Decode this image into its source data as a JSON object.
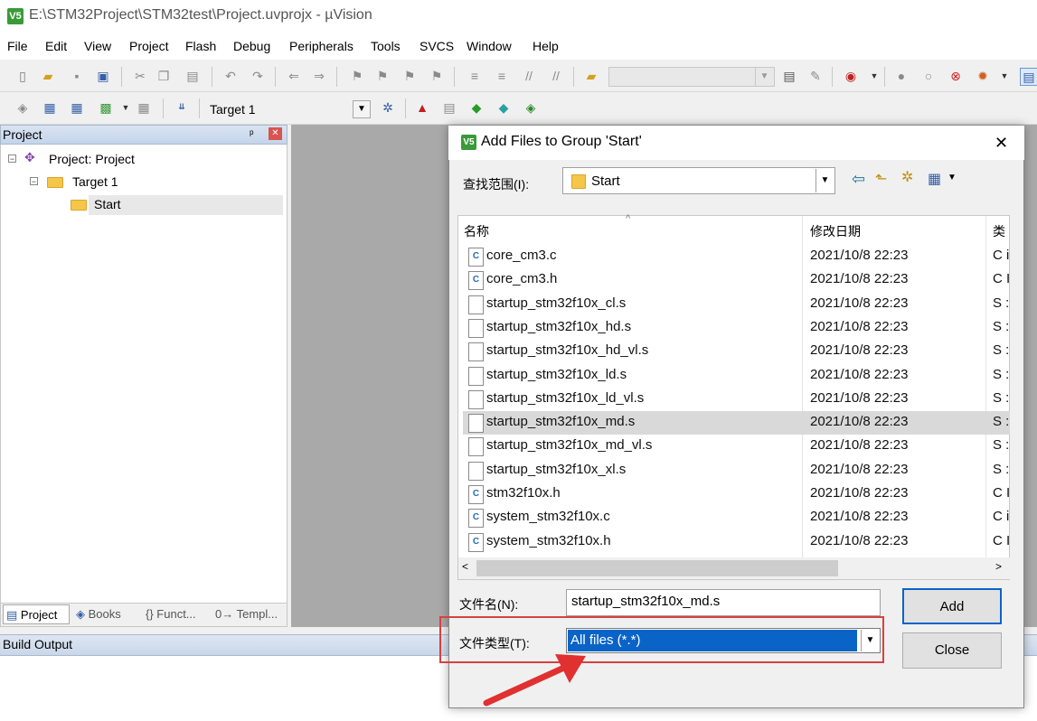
{
  "window": {
    "title": "E:\\STM32Project\\STM32test\\Project.uvprojx - µVision",
    "icon": "V5"
  },
  "menu": [
    "File",
    "Edit",
    "View",
    "Project",
    "Flash",
    "Debug",
    "Peripherals",
    "Tools",
    "SVCS",
    "Window",
    "Help"
  ],
  "toolbar2": {
    "target": "Target 1"
  },
  "project_panel": {
    "header": "Project",
    "tree": {
      "root": "Project: Project",
      "target": "Target 1",
      "group": "Start"
    },
    "tabs": [
      "Project",
      "Books",
      "{} Funct...",
      "0→ Templ..."
    ]
  },
  "build_output": {
    "label": "Build Output"
  },
  "dialog": {
    "title": "Add Files to Group 'Start'",
    "look_in_label": "查找范围(I):",
    "look_in_value": "Start",
    "columns": {
      "name": "名称",
      "date": "修改日期",
      "type": "类"
    },
    "files": [
      {
        "name": "core_cm3.c",
        "date": "2021/10/8 22:23",
        "type": "C i",
        "icon": "c-file-icon"
      },
      {
        "name": "core_cm3.h",
        "date": "2021/10/8 22:23",
        "type": "C I",
        "icon": "c-file-icon"
      },
      {
        "name": "startup_stm32f10x_cl.s",
        "date": "2021/10/8 22:23",
        "type": "S :",
        "icon": "blank-file-icon"
      },
      {
        "name": "startup_stm32f10x_hd.s",
        "date": "2021/10/8 22:23",
        "type": "S :",
        "icon": "blank-file-icon"
      },
      {
        "name": "startup_stm32f10x_hd_vl.s",
        "date": "2021/10/8 22:23",
        "type": "S :",
        "icon": "blank-file-icon"
      },
      {
        "name": "startup_stm32f10x_ld.s",
        "date": "2021/10/8 22:23",
        "type": "S :",
        "icon": "blank-file-icon"
      },
      {
        "name": "startup_stm32f10x_ld_vl.s",
        "date": "2021/10/8 22:23",
        "type": "S :",
        "icon": "blank-file-icon"
      },
      {
        "name": "startup_stm32f10x_md.s",
        "date": "2021/10/8 22:23",
        "type": "S :",
        "icon": "blank-file-icon",
        "selected": true
      },
      {
        "name": "startup_stm32f10x_md_vl.s",
        "date": "2021/10/8 22:23",
        "type": "S :",
        "icon": "blank-file-icon"
      },
      {
        "name": "startup_stm32f10x_xl.s",
        "date": "2021/10/8 22:23",
        "type": "S :",
        "icon": "blank-file-icon"
      },
      {
        "name": "stm32f10x.h",
        "date": "2021/10/8 22:23",
        "type": "C I",
        "icon": "c-file-icon"
      },
      {
        "name": "system_stm32f10x.c",
        "date": "2021/10/8 22:23",
        "type": "C i",
        "icon": "c-file-icon"
      },
      {
        "name": "system_stm32f10x.h",
        "date": "2021/10/8 22:23",
        "type": "C I",
        "icon": "c-file-icon"
      }
    ],
    "file_name_label": "文件名(N):",
    "file_name_value": "startup_stm32f10x_md.s",
    "file_type_label": "文件类型(T):",
    "file_type_value": "All files (*.*)",
    "add_label": "Add",
    "close_label": "Close"
  },
  "colors": {
    "highlight_box": "#d94040",
    "arrow": "#e03030",
    "selection": "#0a64c8"
  }
}
